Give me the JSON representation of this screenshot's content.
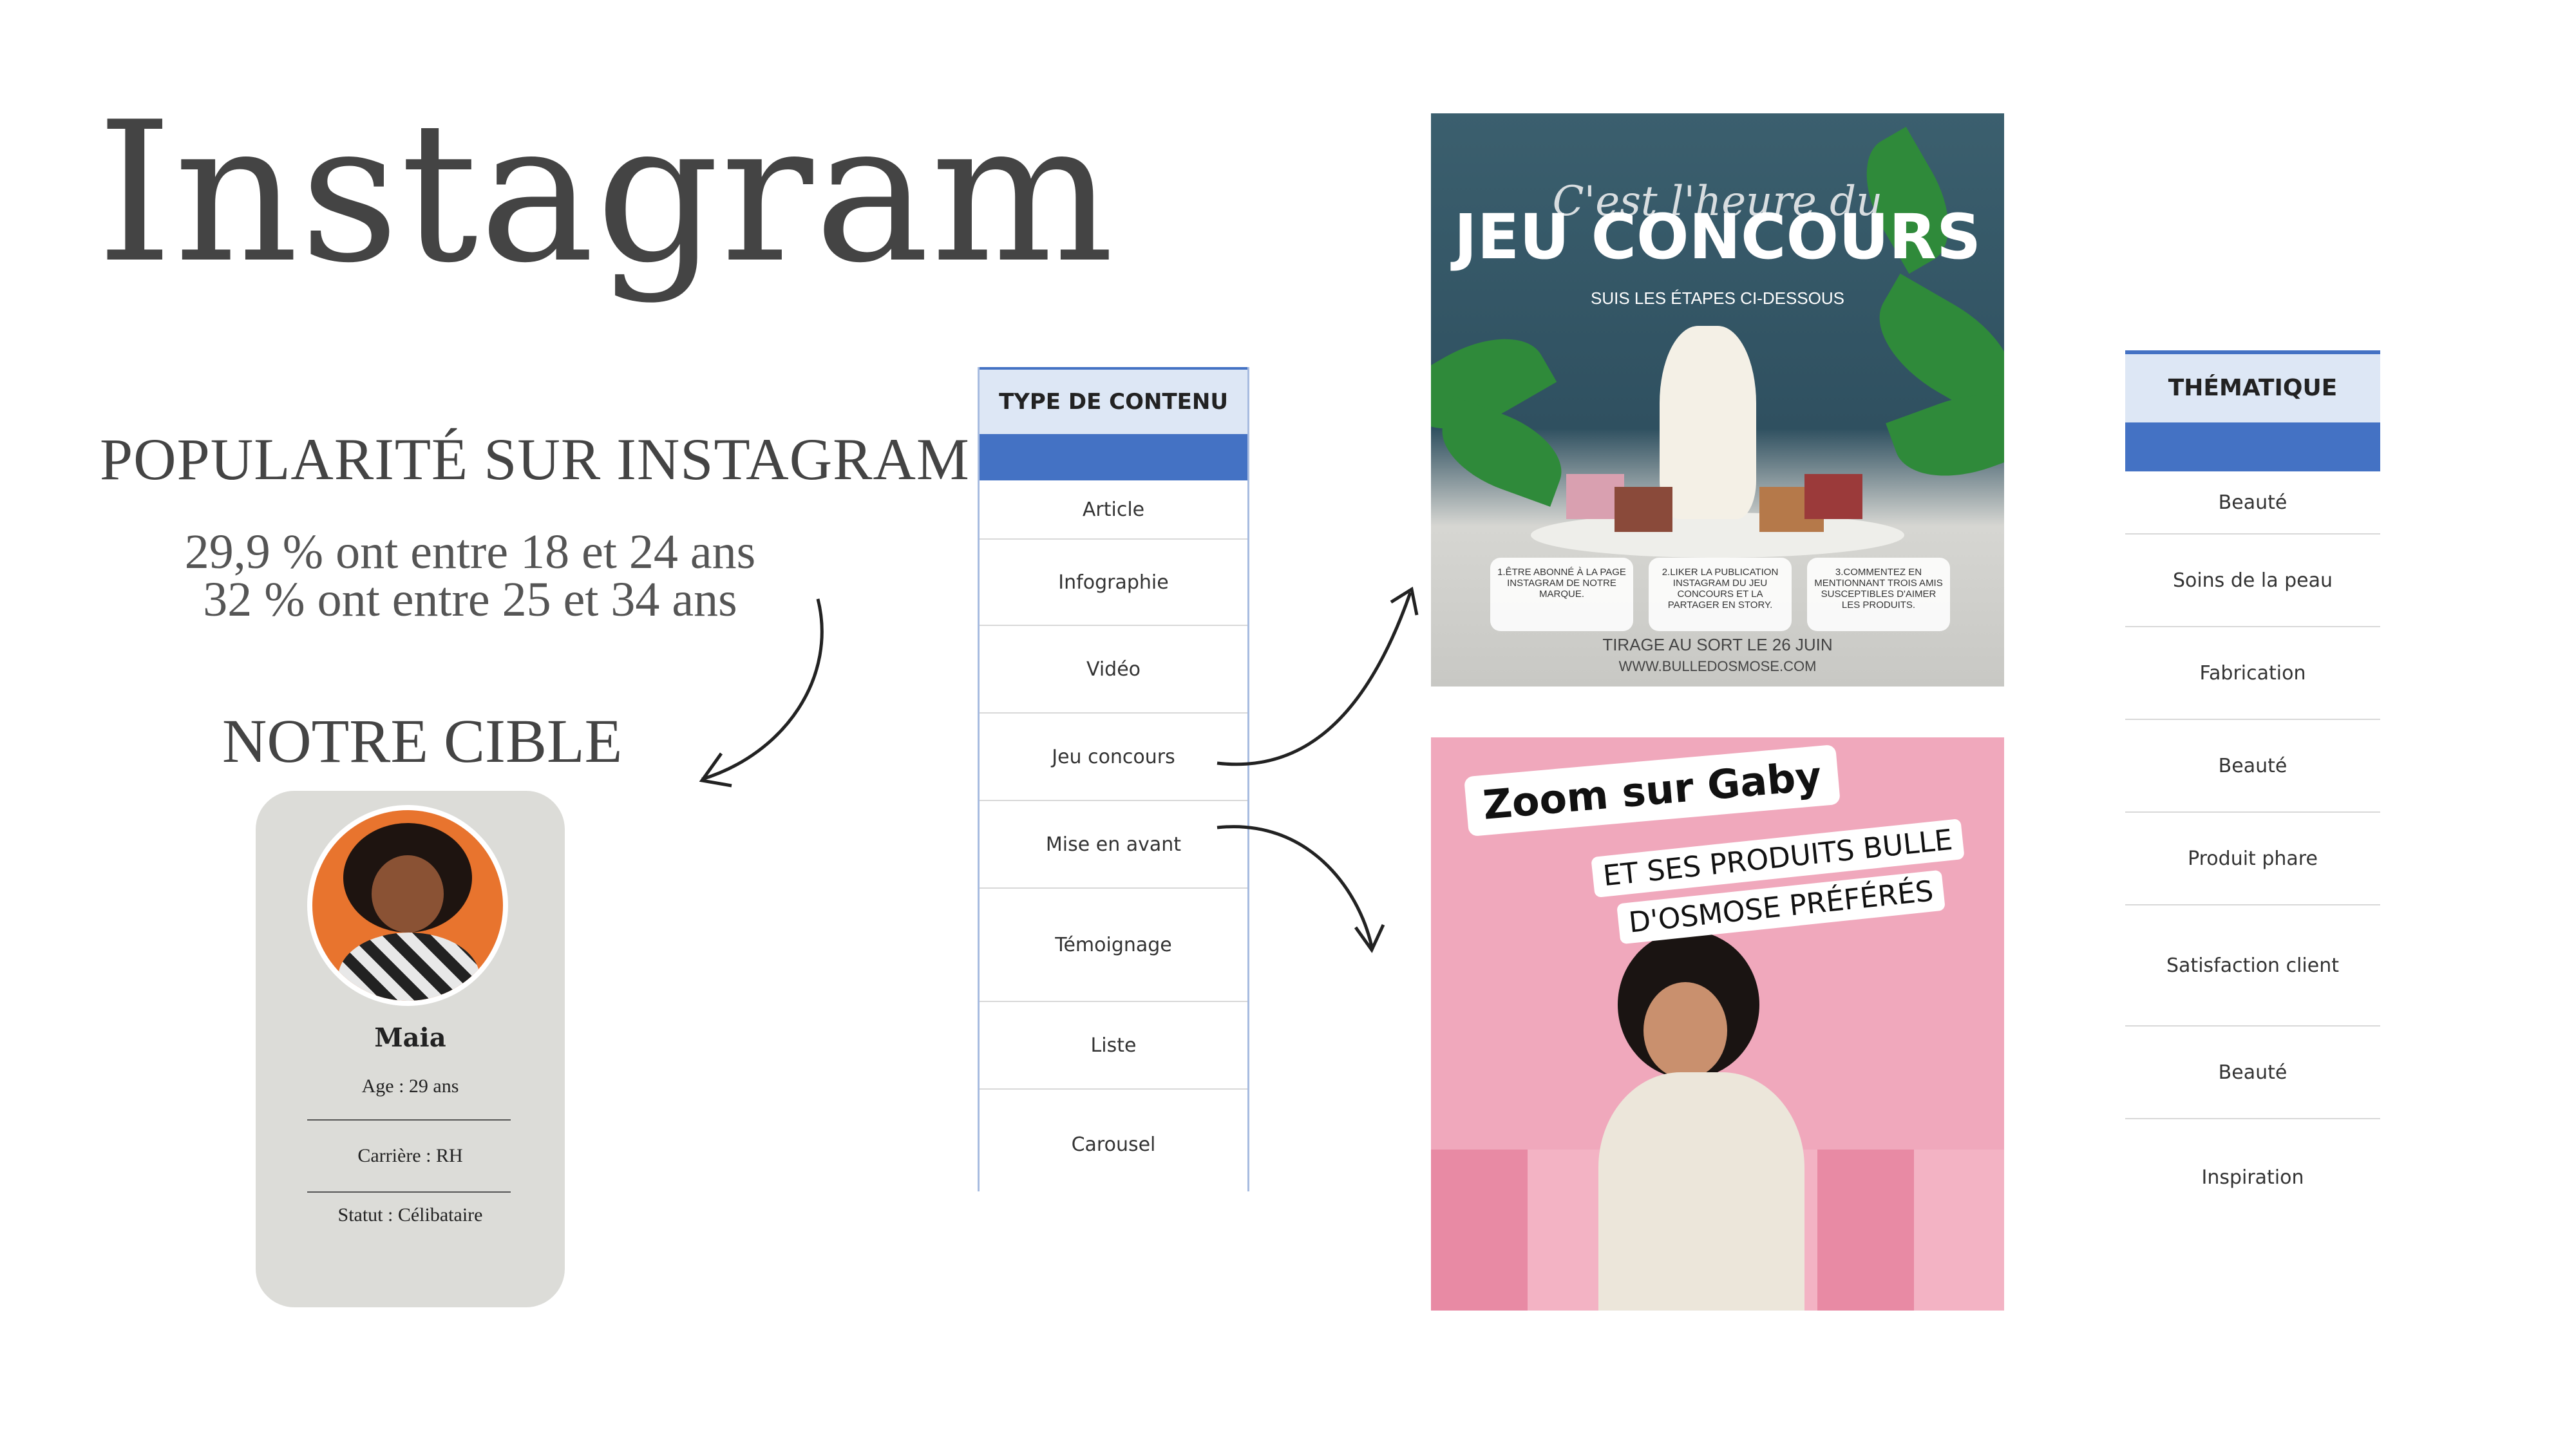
{
  "title": "Instagram",
  "popularity": {
    "heading": "POPULARITÉ SUR INSTAGRAM :",
    "stat_1": "29,9 % ont entre 18 et 24 ans",
    "stat_2": "32 % ont entre 25 et 34 ans"
  },
  "target": {
    "heading": "NOTRE CIBLE",
    "name": "Maia",
    "age": "Age : 29 ans",
    "career": "Carrière : RH",
    "status": "Statut : Célibataire"
  },
  "content_table": {
    "header": "TYPE DE CONTENU",
    "rows": [
      "Article",
      "Infographie",
      "Vidéo",
      "Jeu concours",
      "Mise en avant",
      "Témoignage",
      "Liste",
      "Carousel"
    ]
  },
  "theme_table": {
    "header": "THÉMATIQUE",
    "rows": [
      "Beauté",
      "Soins de la peau",
      "Fabrication",
      "Beauté",
      "Produit phare",
      "Satisfaction client",
      "Beauté",
      "Inspiration"
    ]
  },
  "contest_post": {
    "script_line": "C'est l'heure du",
    "headline": "JEU CONCOURS",
    "subline": "SUIS LES ÉTAPES CI-DESSOUS",
    "step_1": "1.ÊTRE ABONNÉ À LA PAGE INSTAGRAM DE NOTRE MARQUE.",
    "step_2": "2.LIKER LA PUBLICATION INSTAGRAM DU JEU CONCOURS ET LA PARTAGER EN STORY.",
    "step_3": "3.COMMENTEZ EN MENTIONNANT TROIS AMIS SUSCEPTIBLES D'AIMER LES PRODUITS.",
    "draw_date": "TIRAGE AU SORT LE 26 JUIN",
    "website": "WWW.BULLEDOSMOSE.COM"
  },
  "zoom_post": {
    "title": "Zoom sur Gaby",
    "line_1": "ET SES PRODUITS BULLE",
    "line_2": "D'OSMOSE PRÉFÉRÉS"
  },
  "colors": {
    "table_accent": "#4472c4",
    "table_header_bg": "#dde7f5",
    "card_bg": "#dcdcd8",
    "contest_bg": "#2f5060",
    "zoom_bg": "#f0a8bc"
  }
}
